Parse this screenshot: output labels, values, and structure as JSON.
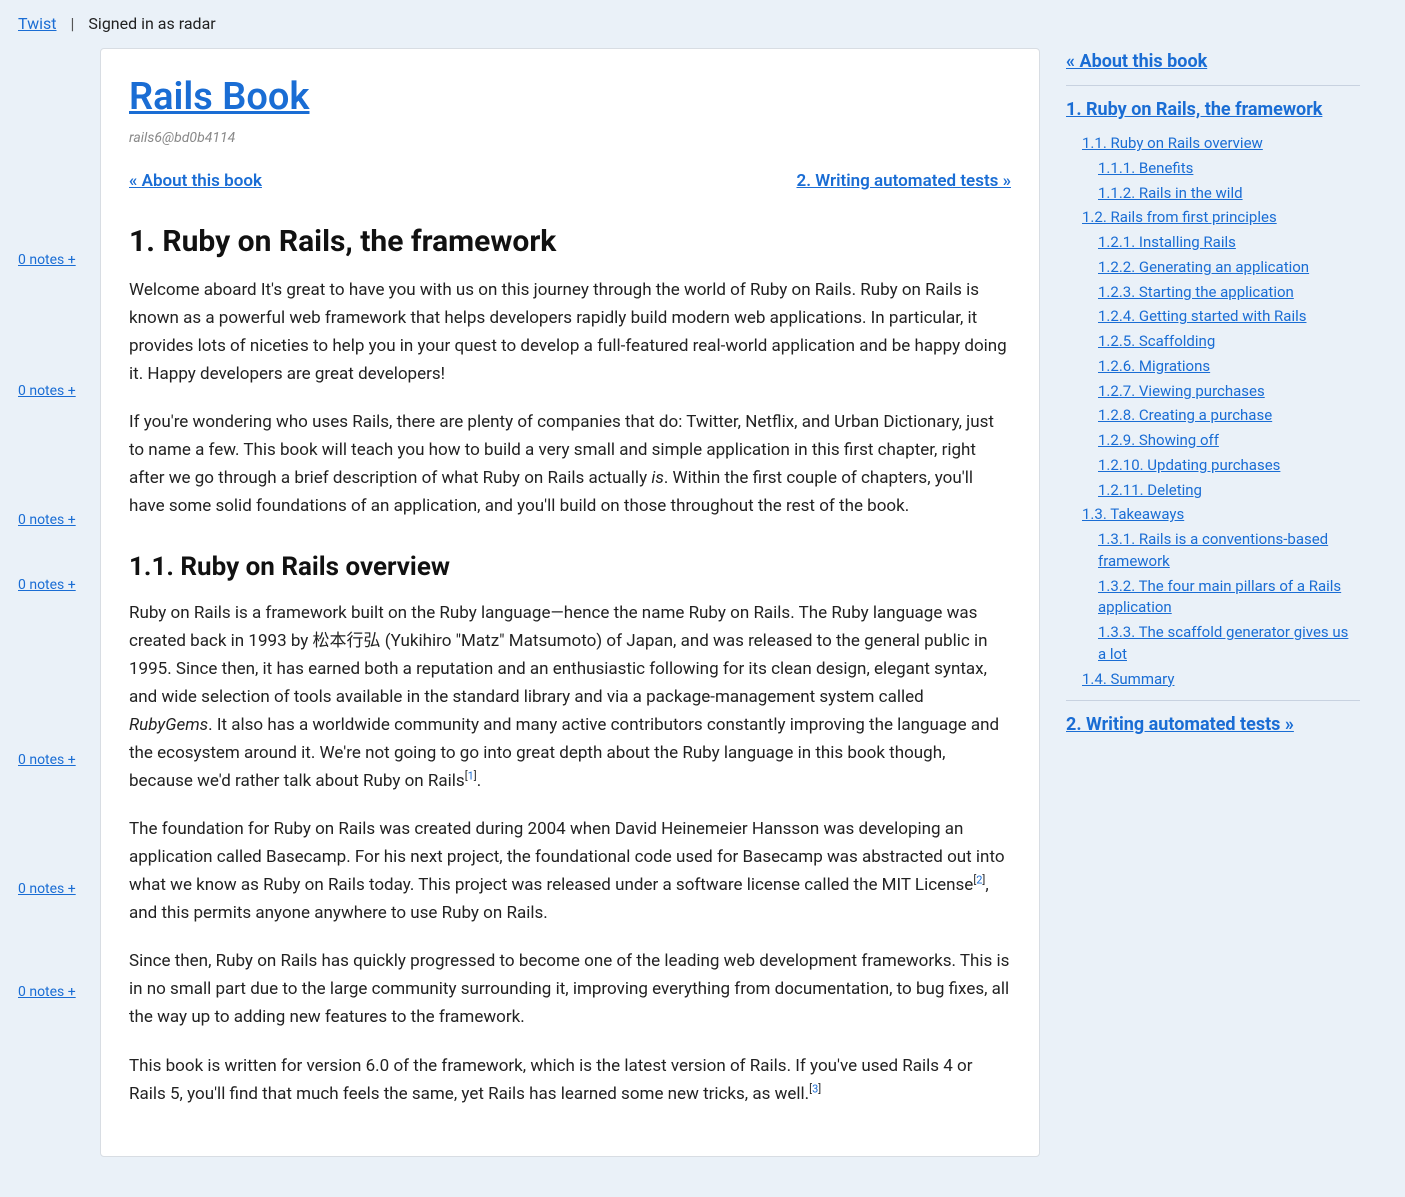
{
  "topbar": {
    "brand": "Twist",
    "signed_in_prefix": "Signed in as ",
    "username": "radar"
  },
  "gutter": {
    "notes": [
      "0 notes +",
      "0 notes +",
      "0 notes +",
      "0 notes +",
      "0 notes +",
      "0 notes +",
      "0 notes +"
    ],
    "offsets": [
      0,
      110,
      108,
      44,
      154,
      108,
      82
    ]
  },
  "content": {
    "title": "Rails Book",
    "meta": "rails6@bd0b4114",
    "nav_prev": "« About this book",
    "nav_next": "2. Writing automated tests »",
    "h1": "1. Ruby on Rails, the framework",
    "p1": "Welcome aboard It's great to have you with us on this journey through the world of Ruby on Rails. Ruby on Rails is known as a powerful web framework that helps developers rapidly build modern web applications. In particular, it provides lots of niceties to help you in your quest to develop a full-featured real-world application and be happy doing it. Happy developers are great developers!",
    "p2a": "If you're wondering who uses Rails, there are plenty of companies that do: Twitter, Netflix, and Urban Dictionary, just to name a few. This book will teach you how to build a very small and simple application in this first chapter, right after we go through a brief description of what Ruby on Rails actually ",
    "p2_em": "is",
    "p2b": ". Within the first couple of chapters, you'll have some solid foundations of an application, and you'll build on those throughout the rest of the book.",
    "h2": "1.1. Ruby on Rails overview",
    "p3a": "Ruby on Rails is a framework built on the Ruby language—hence the name Ruby on Rails. The Ruby language was created back in 1993 by 松本行弘 (Yukihiro \"Matz\" Matsumoto) of Japan, and was released to the general public in 1995. Since then, it has earned both a reputation and an enthusiastic following for its clean design, elegant syntax, and wide selection of tools available in the standard library and via a package-management system called ",
    "p3_em": "RubyGems",
    "p3b": ". It also has a worldwide community and many active contributors constantly improving the language and the ecosystem around it. We're not going to go into great depth about the Ruby language in this book though, because we'd rather talk about Ruby on Rails",
    "fn1": "1",
    "p3c": ".",
    "p4a": "The foundation for Ruby on Rails was created during 2004 when David Heinemeier Hansson was developing an application called Basecamp. For his next project, the foundational code used for Basecamp was abstracted out into what we know as Ruby on Rails today. This project was released under a software license called the MIT License",
    "fn2": "2",
    "p4b": ", and this permits anyone anywhere to use Ruby on Rails.",
    "p5": "Since then, Ruby on Rails has quickly progressed to become one of the leading web development frameworks. This is in no small part due to the large community surrounding it, improving everything from documentation, to bug fixes, all the way up to adding new features to the framework.",
    "p6a": "This book is written for version 6.0 of the framework, which is the latest version of Rails. If you've used Rails 4 or Rails 5, you'll find that much feels the same, yet Rails has learned some new tricks, as well.",
    "fn3": "3"
  },
  "sidebar": {
    "top": "« About this book",
    "chapter": "1. Ruby on Rails, the framework",
    "items": [
      {
        "label": "1.1. Ruby on Rails overview",
        "children": [
          {
            "label": "1.1.1. Benefits"
          },
          {
            "label": "1.1.2. Rails in the wild"
          }
        ]
      },
      {
        "label": "1.2. Rails from first principles",
        "children": [
          {
            "label": "1.2.1. Installing Rails"
          },
          {
            "label": "1.2.2. Generating an application"
          },
          {
            "label": "1.2.3. Starting the application"
          },
          {
            "label": "1.2.4. Getting started with Rails"
          },
          {
            "label": "1.2.5. Scaffolding"
          },
          {
            "label": "1.2.6. Migrations"
          },
          {
            "label": "1.2.7. Viewing purchases"
          },
          {
            "label": "1.2.8. Creating a purchase"
          },
          {
            "label": "1.2.9. Showing off"
          },
          {
            "label": "1.2.10. Updating purchases"
          },
          {
            "label": "1.2.11. Deleting"
          }
        ]
      },
      {
        "label": "1.3. Takeaways",
        "children": [
          {
            "label": "1.3.1. Rails is a conventions-based framework"
          },
          {
            "label": "1.3.2. The four main pillars of a Rails application"
          },
          {
            "label": "1.3.3. The scaffold generator gives us a lot"
          }
        ]
      },
      {
        "label": "1.4. Summary",
        "children": []
      }
    ],
    "bottom": "2. Writing automated tests »"
  }
}
